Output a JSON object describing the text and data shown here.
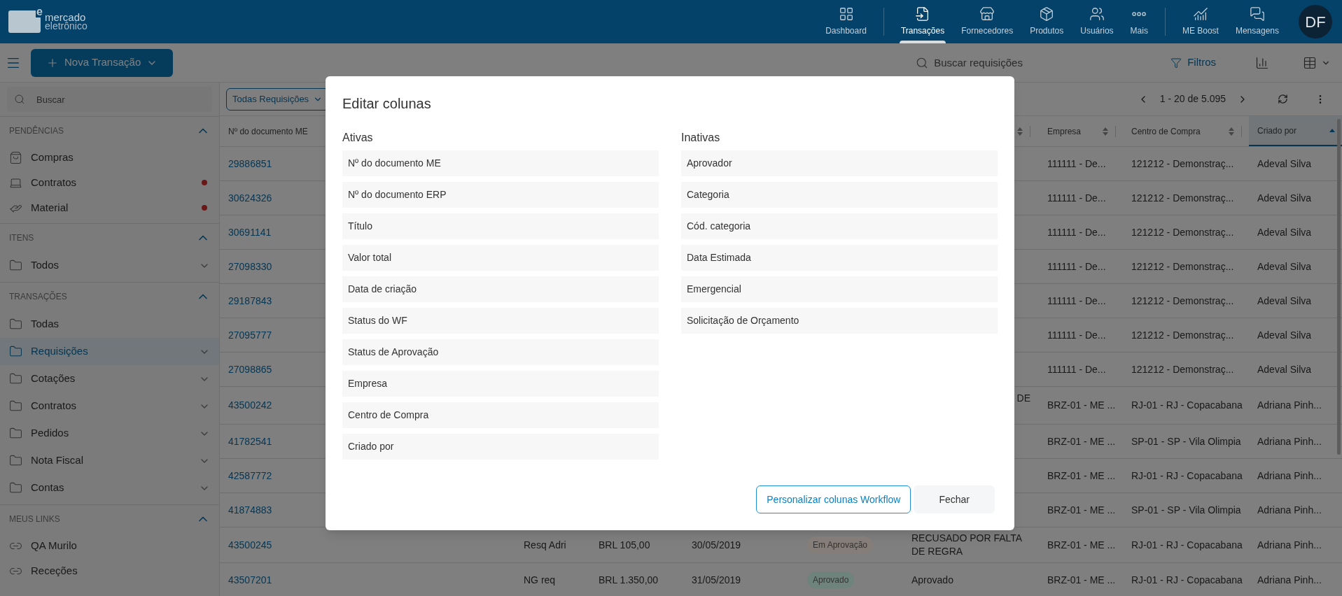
{
  "header": {
    "logo": {
      "mark": "e",
      "line1": "mercado",
      "line2": "eletrônico"
    },
    "nav_groups": [
      [
        {
          "label": "Dashboard",
          "selected": false
        }
      ],
      [
        {
          "label": "Transações",
          "selected": true
        },
        {
          "label": "Fornecedores",
          "selected": false
        },
        {
          "label": "Produtos",
          "selected": false
        },
        {
          "label": "Usuários",
          "selected": false
        },
        {
          "label": "Mais",
          "selected": false
        }
      ],
      [
        {
          "label": "ME Boost",
          "selected": false
        },
        {
          "label": "Mensagens",
          "selected": false
        }
      ]
    ],
    "avatar": "DF"
  },
  "toolbar": {
    "new_button": "Nova Transação",
    "search": {
      "placeholder": "Buscar requisições"
    },
    "filters": "Filtros"
  },
  "sidebar": {
    "search": {
      "placeholder": "Buscar"
    },
    "sections": [
      {
        "title": "PENDÊNCIAS",
        "expanded": true,
        "items": [
          {
            "label": "Compras",
            "kind": "purchase",
            "selected": false,
            "alert": false,
            "expandable": false
          },
          {
            "label": "Contratos",
            "kind": "contract",
            "selected": false,
            "alert": true,
            "expandable": false
          },
          {
            "label": "Material",
            "kind": "material",
            "selected": false,
            "alert": true,
            "expandable": false
          }
        ]
      },
      {
        "title": "ITENS",
        "expanded": true,
        "items": [
          {
            "label": "Todos",
            "kind": "folder",
            "selected": false,
            "alert": false,
            "expandable": true
          }
        ]
      },
      {
        "title": "TRANSAÇÕES",
        "expanded": true,
        "items": [
          {
            "label": "Todas",
            "kind": "folder",
            "selected": false,
            "alert": false,
            "expandable": false
          },
          {
            "label": "Requisições",
            "kind": "folder",
            "selected": true,
            "alert": false,
            "expandable": true
          },
          {
            "label": "Cotações",
            "kind": "folder",
            "selected": false,
            "alert": false,
            "expandable": true
          },
          {
            "label": "Contratos",
            "kind": "folder",
            "selected": false,
            "alert": false,
            "expandable": true
          },
          {
            "label": "Pedidos",
            "kind": "folder",
            "selected": false,
            "alert": false,
            "expandable": true
          },
          {
            "label": "Nota Fiscal",
            "kind": "folder",
            "selected": false,
            "alert": false,
            "expandable": true
          },
          {
            "label": "Contas",
            "kind": "folder",
            "selected": false,
            "alert": false,
            "expandable": true
          }
        ]
      },
      {
        "title": "MEUS LINKS",
        "expanded": true,
        "items": [
          {
            "label": "QA Murilo",
            "kind": "link",
            "selected": false,
            "alert": false,
            "expandable": false
          },
          {
            "label": "Receções",
            "kind": "link",
            "selected": false,
            "alert": false,
            "expandable": false
          }
        ]
      }
    ]
  },
  "table": {
    "view": "Todas Requisições",
    "pagination": "1 - 20 de 5.095",
    "columns": [
      {
        "label": "Nº do documento ME",
        "sorted": false
      },
      {
        "label": "Empresa",
        "sorted": false
      },
      {
        "label": "Centro de Compra",
        "sorted": false
      },
      {
        "label": "Criado por",
        "sorted": true
      }
    ],
    "rows": [
      {
        "doc": "29886851",
        "empresa": "111111 - De...",
        "centro": "121212 - Demonstraç...",
        "criado_por": "Adeval Silva"
      },
      {
        "doc": "30624326",
        "empresa": "111111 - De...",
        "centro": "121212 - Demonstraç...",
        "criado_por": "Adeval Silva"
      },
      {
        "doc": "30691141",
        "empresa": "111111 - De...",
        "centro": "121212 - Demonstraç...",
        "criado_por": "Adeval Silva"
      },
      {
        "doc": "27098330",
        "empresa": "111111 - De...",
        "centro": "121212 - Demonstraç...",
        "criado_por": "Adeval Silva"
      },
      {
        "doc": "29187843",
        "empresa": "111111 - De...",
        "centro": "121212 - Demonstraç...",
        "criado_por": "Adeval Silva"
      },
      {
        "doc": "27095777",
        "empresa": "111111 - De...",
        "centro": "121212 - Demonstraç...",
        "criado_por": "Adeval Silva"
      },
      {
        "doc": "27098865",
        "empresa": "111111 - De...",
        "centro": "121212 - Demonstraç...",
        "criado_por": "Adeval Silva"
      },
      {
        "doc": "43500242",
        "wf_status_tail": "DE",
        "empresa": "BRZ-01 - ME ...",
        "centro": "RJ-01 - RJ - Copacabana",
        "criado_por": "Adriana Pinh..."
      },
      {
        "doc": "41782541",
        "empresa": "BRZ-01 - ME ...",
        "centro": "SP-01 - SP - Vila Olimpia",
        "criado_por": "Adriana Pinh..."
      },
      {
        "doc": "42587772",
        "empresa": "BRZ-01 - ME ...",
        "centro": "RJ-01 - RJ - Copacabana",
        "criado_por": "Adriana Pinh..."
      },
      {
        "doc": "41874883",
        "empresa": "BRZ-01 - ME ...",
        "centro": "SP-01 - SP - Vila Olimpia",
        "criado_por": "Adriana Pinh..."
      },
      {
        "doc": "43500245",
        "title": "Resq Adri",
        "value": "BRL 105,00",
        "date": "30/05/2019",
        "status": {
          "label": "Em Aprovação",
          "color": "#857d77"
        },
        "wf_status": "RECUSADO POR FALTA DE REGRA",
        "empresa": "BRZ-01 - ME ...",
        "centro": "RJ-01 - RJ - Copacabana",
        "criado_por": "Adriana Pinh..."
      },
      {
        "doc": "43507201",
        "title": "NG req",
        "value": "BRL 1.350,00",
        "date": "31/05/2019",
        "status": {
          "label": "Aprovado",
          "color": "#6f837d"
        },
        "wf_status": "Aprovado",
        "empresa": "BRZ-01 - ME ...",
        "centro": "RJ-01 - RJ - Copacabana",
        "criado_por": "Adriana Pinh..."
      }
    ]
  },
  "modal": {
    "title": "Editar colunas",
    "active": {
      "title": "Ativas",
      "items": [
        "Nº do documento ME",
        "Nº do documento ERP",
        "Título",
        "Valor total",
        "Data de criação",
        "Status do WF",
        "Status de Aprovação",
        "Empresa",
        "Centro de Compra",
        "Criado por"
      ]
    },
    "inactive": {
      "title": "Inativas",
      "items": [
        "Aprovador",
        "Categoria",
        "Cód. categoria",
        "Data Estimada",
        "Emergencial",
        "Solicitação de Orçamento"
      ]
    },
    "buttons": [
      {
        "label": "Personalizar colunas Workflow",
        "kind": "outline"
      },
      {
        "label": "Fechar",
        "kind": "plain"
      }
    ]
  }
}
